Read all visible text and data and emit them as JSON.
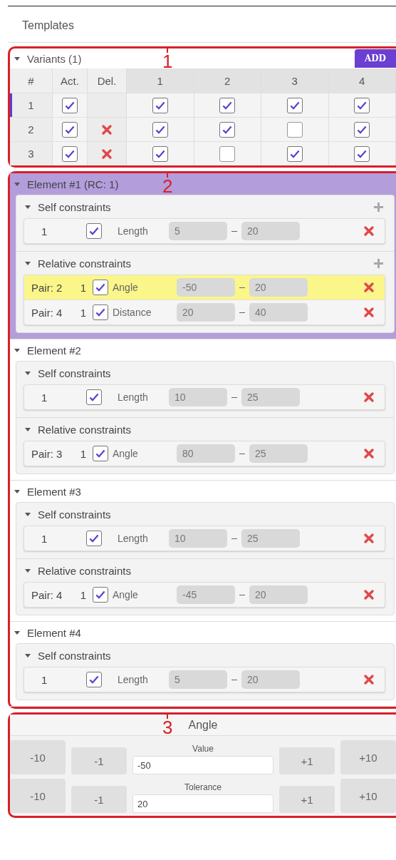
{
  "title": "Templates",
  "callouts": [
    "1",
    "2",
    "3"
  ],
  "variants": {
    "title": "Variants (1)",
    "add": "ADD",
    "columns": [
      "#",
      "Act.",
      "Del.",
      "1",
      "2",
      "3",
      "4"
    ],
    "rows": [
      {
        "num": "1",
        "selected": true,
        "active": true,
        "deletable": false,
        "flags": [
          true,
          true,
          true,
          true
        ]
      },
      {
        "num": "2",
        "selected": false,
        "active": true,
        "deletable": true,
        "flags": [
          true,
          true,
          false,
          true
        ]
      },
      {
        "num": "3",
        "selected": false,
        "active": true,
        "deletable": true,
        "flags": [
          true,
          false,
          true,
          true
        ]
      }
    ]
  },
  "elements": [
    {
      "title": "Element #1 (RC: 1)",
      "highlighted": true,
      "sections": [
        {
          "kind": "self",
          "title": "Self constraints",
          "add": true,
          "rows": [
            {
              "index": "1",
              "checked": true,
              "name": "Length",
              "min": "5",
              "max": "20",
              "selected": false
            }
          ]
        },
        {
          "kind": "relative",
          "title": "Relative constraints",
          "add": true,
          "rows": [
            {
              "pair": "Pair: 2",
              "index": "1",
              "checked": true,
              "name": "Angle",
              "min": "-50",
              "max": "20",
              "selected": true
            },
            {
              "pair": "Pair: 4",
              "index": "1",
              "checked": true,
              "name": "Distance",
              "min": "20",
              "max": "40",
              "selected": false
            }
          ]
        }
      ]
    },
    {
      "title": "Element #2",
      "highlighted": false,
      "sections": [
        {
          "kind": "self",
          "title": "Self constraints",
          "add": false,
          "rows": [
            {
              "index": "1",
              "checked": true,
              "name": "Length",
              "min": "10",
              "max": "25",
              "selected": false
            }
          ]
        },
        {
          "kind": "relative",
          "title": "Relative constraints",
          "add": false,
          "rows": [
            {
              "pair": "Pair: 3",
              "index": "1",
              "checked": true,
              "name": "Angle",
              "min": "80",
              "max": "25",
              "selected": false
            }
          ]
        }
      ]
    },
    {
      "title": "Element #3",
      "highlighted": false,
      "sections": [
        {
          "kind": "self",
          "title": "Self constraints",
          "add": false,
          "rows": [
            {
              "index": "1",
              "checked": true,
              "name": "Length",
              "min": "10",
              "max": "25",
              "selected": false
            }
          ]
        },
        {
          "kind": "relative",
          "title": "Relative constraints",
          "add": false,
          "rows": [
            {
              "pair": "Pair: 4",
              "index": "1",
              "checked": true,
              "name": "Angle",
              "min": "-45",
              "max": "20",
              "selected": false
            }
          ]
        }
      ]
    },
    {
      "title": "Element #4",
      "highlighted": false,
      "sections": [
        {
          "kind": "self",
          "title": "Self constraints",
          "add": false,
          "rows": [
            {
              "index": "1",
              "checked": true,
              "name": "Length",
              "min": "5",
              "max": "20",
              "selected": false
            }
          ]
        }
      ]
    }
  ],
  "editor": {
    "title": "Angle",
    "rows": [
      {
        "label": "Value",
        "value": "-50",
        "buttons": [
          "-10",
          "-1",
          "+1",
          "+10"
        ]
      },
      {
        "label": "Tolerance",
        "value": "20",
        "buttons": [
          "-10",
          "-1",
          "+1",
          "+10"
        ]
      }
    ]
  }
}
